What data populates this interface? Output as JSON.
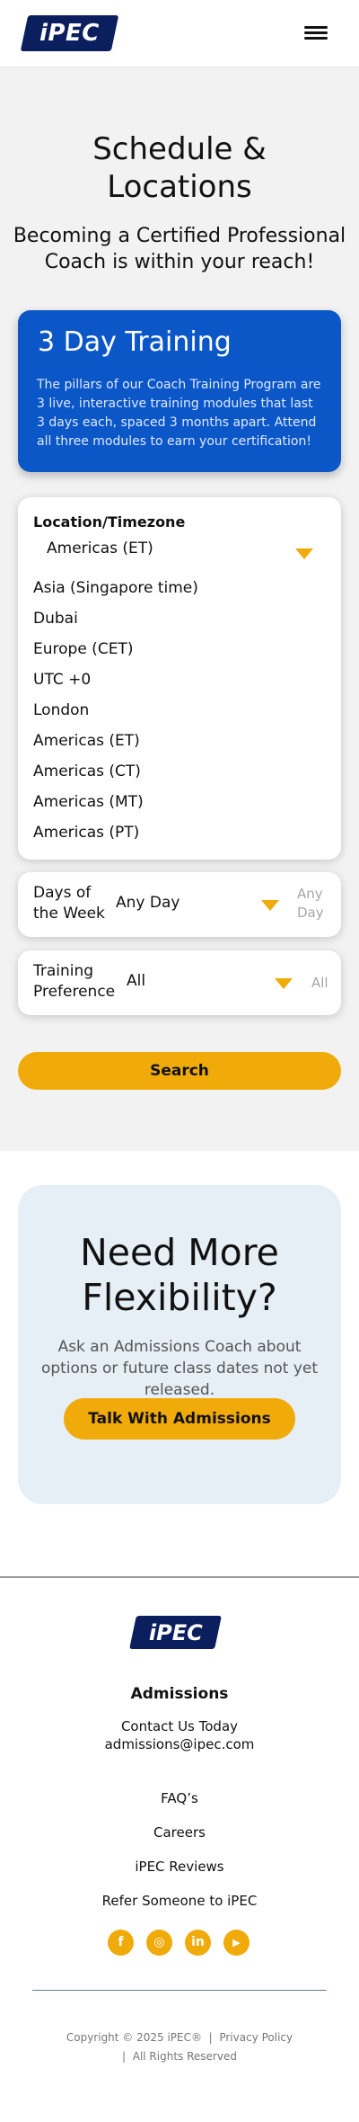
{
  "header": {
    "logo_text": "iPEC",
    "menu_icon": "hamburger-menu-icon"
  },
  "hero": {
    "title": "Schedule & Locations",
    "subtitle": "Becoming a Certified Professional Coach is within your reach!"
  },
  "training": {
    "title": "3 Day Training",
    "description": "The pillars of our Coach Training Program are 3 live, interactive training modules that last 3 days each, spaced 3 months apart. Attend all three modules to earn your certification!"
  },
  "location_filter": {
    "label": "Location/Timezone",
    "selected": "Americas (ET)",
    "options": [
      "Asia (Singapore time)",
      "Dubai",
      "Europe (CET)",
      "UTC +0",
      "London",
      "Americas (ET)",
      "Americas (CT)",
      "Americas (MT)",
      "Americas (PT)"
    ]
  },
  "days_filter": {
    "label": "Days of the Week",
    "value": "Any Day",
    "ghost": "Any Day"
  },
  "preference_filter": {
    "label": "Training Preference",
    "value": "All",
    "ghost": "All"
  },
  "search_label": "Search",
  "flexibility": {
    "title": "Need More Flexibility?",
    "text": "Ask an Admissions Coach about options or future class dates not yet released.",
    "button": "Talk With Admissions"
  },
  "footer": {
    "logo_text": "iPEC",
    "heading": "Admissions",
    "contact": "Contact Us Today",
    "email": "admissions@ipec.com",
    "links": [
      "FAQ’s",
      "Careers",
      "iPEC Reviews",
      "Refer Someone to iPEC"
    ],
    "socials": [
      {
        "icon": "facebook-icon",
        "glyph": "f"
      },
      {
        "icon": "instagram-icon",
        "glyph": "◎"
      },
      {
        "icon": "linkedin-icon",
        "glyph": "in"
      },
      {
        "icon": "youtube-icon",
        "glyph": "▶"
      }
    ],
    "copyright": "Copyright © 2025 iPEC®",
    "separator": "|",
    "privacy": "Privacy Policy",
    "rights": "All Rights Reserved"
  },
  "colors": {
    "brand_navy": "#0b1f5f",
    "training_blue": "#0b57c8",
    "accent_yellow": "#f0ab0a",
    "flex_bg": "#e6eef6"
  }
}
